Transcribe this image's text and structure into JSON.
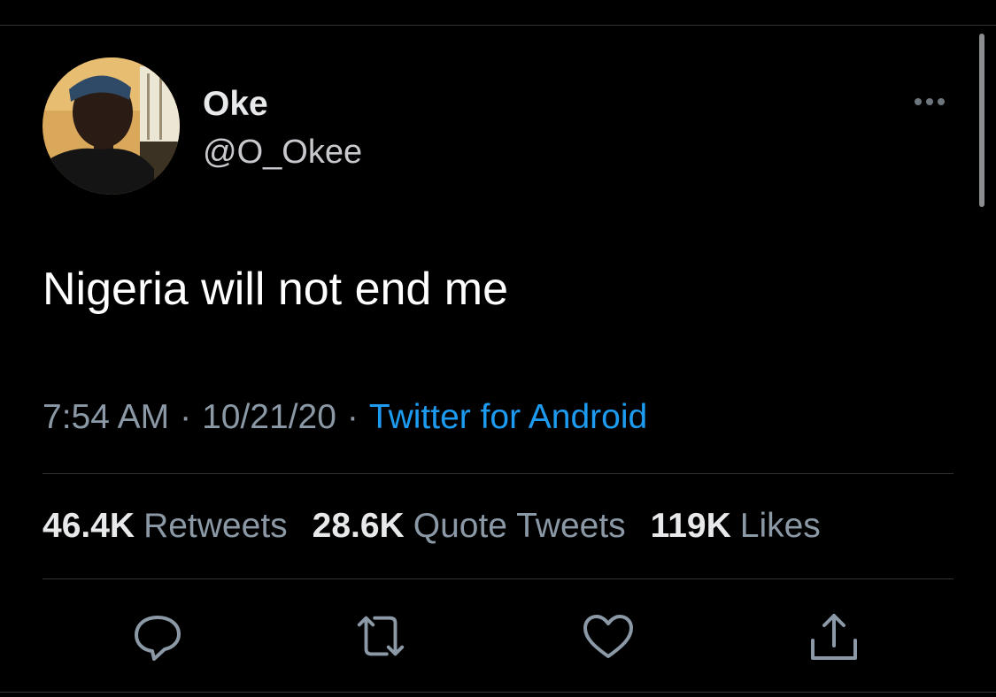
{
  "user": {
    "display_name": "Oke",
    "handle": "@O_Okee"
  },
  "tweet": {
    "text": "Nigeria will not end me",
    "time": "7:54 AM",
    "date": "10/21/20",
    "separator": "·",
    "source": "Twitter for Android"
  },
  "stats": [
    {
      "count": "46.4K",
      "label": "Retweets"
    },
    {
      "count": "28.6K",
      "label": "Quote Tweets"
    },
    {
      "count": "119K",
      "label": "Likes"
    }
  ],
  "actions": [
    "reply-icon",
    "retweet-icon",
    "like-icon",
    "share-icon"
  ],
  "colors": {
    "background": "#000000",
    "link": "#1d9bf0",
    "secondary_text": "#8b98a5",
    "divider": "#2f3336"
  }
}
